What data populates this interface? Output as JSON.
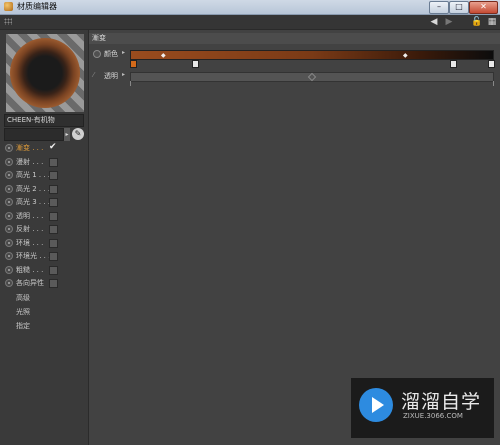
{
  "window": {
    "title": "材质编辑器",
    "buttons": {
      "minimize": "–",
      "maximize": "□",
      "close": "✕"
    }
  },
  "toolbar": {
    "icons": [
      "back-arrow-icon",
      "forward-arrow-icon",
      "unlock-icon",
      "window-menu-icon"
    ],
    "glyphs": {
      "back": "◀",
      "forward": "▶",
      "lock": "🔓",
      "menu": "▦"
    }
  },
  "material": {
    "name": "CHEEN-有机物",
    "arrow": "▸",
    "picker": "✎"
  },
  "channels": [
    {
      "label": "漸变 . . .",
      "checked": true,
      "active": true
    },
    {
      "label": "漫射 . . .",
      "checked": false
    },
    {
      "label": "高光 1 . . .",
      "checked": false
    },
    {
      "label": "高光 2 . . .",
      "checked": false
    },
    {
      "label": "高光 3 . . .",
      "checked": false
    },
    {
      "label": "透明 . . .",
      "checked": false
    },
    {
      "label": "反射 . . .",
      "checked": false
    },
    {
      "label": "环境 . . .",
      "checked": false
    },
    {
      "label": "环境光 . . .",
      "checked": false
    },
    {
      "label": "粗糙 . . .",
      "checked": false
    },
    {
      "label": "各向异性",
      "checked": false
    }
  ],
  "extra_items": [
    "高级",
    "光照",
    "指定"
  ],
  "check_glyph": "✔",
  "panel": {
    "section_title": "漸变",
    "color_row": {
      "label": "颜色",
      "arrow": "▸",
      "knot": "◆"
    },
    "transparency_row": {
      "label": "透明",
      "arrow": "▸"
    },
    "gradient_colors": [
      "#9a4c1e",
      "#7a3a16",
      "#3a1a0a",
      "#0c0c0c"
    ]
  },
  "watermark": {
    "title": "溜溜自学",
    "url": "ZIXUE.3066.COM"
  }
}
